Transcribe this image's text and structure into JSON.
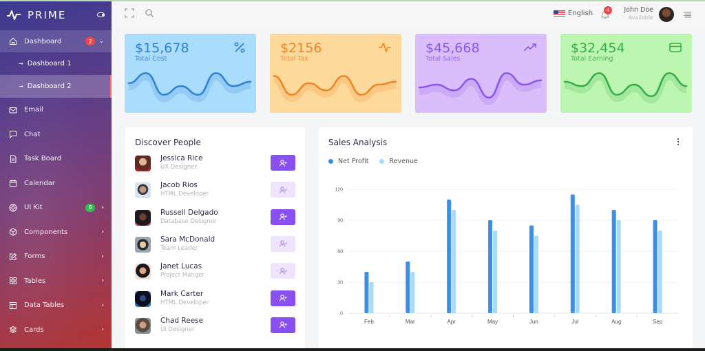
{
  "brand": {
    "name": "PRIME"
  },
  "sidebar": {
    "items": [
      {
        "label": "Dashboard",
        "icon": "home-icon",
        "badge": "2",
        "badge_color": "#f04646",
        "expanded": true,
        "children": [
          {
            "label": "Dashboard 1"
          },
          {
            "label": "Dashboard 2",
            "current": true
          }
        ]
      },
      {
        "label": "Email",
        "icon": "mail-icon"
      },
      {
        "label": "Chat",
        "icon": "chat-icon"
      },
      {
        "label": "Task Board",
        "icon": "file-icon"
      },
      {
        "label": "Calendar",
        "icon": "calendar-icon"
      },
      {
        "label": "UI Kit",
        "icon": "aperture-icon",
        "badge": "6",
        "badge_color": "#2fbf4e",
        "has_children": true
      },
      {
        "label": "Components",
        "icon": "box-icon",
        "has_children": true
      },
      {
        "label": "Forms",
        "icon": "edit-icon",
        "has_children": true
      },
      {
        "label": "Tables",
        "icon": "grid-icon",
        "has_children": true
      },
      {
        "label": "Data Tables",
        "icon": "layout-icon",
        "has_children": true
      },
      {
        "label": "Cards",
        "icon": "layers-icon",
        "has_children": true
      }
    ]
  },
  "header": {
    "language": "English",
    "notifications": "4",
    "user": {
      "name": "John Doe",
      "status": "Available"
    }
  },
  "stats": [
    {
      "value": "$15,678",
      "label": "Total Cost",
      "icon": "percent-icon",
      "color": "#2e7fd8",
      "spark": [
        0.45,
        0.1,
        0.85,
        0.55,
        0.85,
        0.1,
        0.55,
        0.4
      ]
    },
    {
      "value": "$2156",
      "label": "Total Tax",
      "icon": "activity-icon",
      "color": "#ef8424",
      "spark": [
        0.2,
        0.85,
        0.45,
        0.7,
        0.2,
        0.85,
        0.5,
        0.4
      ]
    },
    {
      "value": "$45,668",
      "label": "Total Sales",
      "icon": "trending-up-icon",
      "color": "#8c55ee",
      "spark": [
        0.6,
        0.5,
        0.7,
        0.3,
        0.95,
        0.1,
        0.5,
        0.35
      ]
    },
    {
      "value": "$32,454",
      "label": "Total Earning",
      "icon": "credit-card-icon",
      "color": "#32ad47",
      "spark": [
        0.4,
        0.55,
        0.1,
        0.85,
        0.5,
        0.9,
        0.1,
        0.55
      ]
    }
  ],
  "discover": {
    "title": "Discover People",
    "people": [
      {
        "name": "Jessica Rice",
        "role": "UX Designer",
        "followed": false
      },
      {
        "name": "Jacob Rios",
        "role": "HTML Developer",
        "followed": true
      },
      {
        "name": "Russell Delgado",
        "role": "Database Designer",
        "followed": false
      },
      {
        "name": "Sara McDonald",
        "role": "Team Leader",
        "followed": true
      },
      {
        "name": "Janet Lucas",
        "role": "Project Manger",
        "followed": true
      },
      {
        "name": "Mark Carter",
        "role": "HTML Developer",
        "followed": false
      },
      {
        "name": "Chad Reese",
        "role": "UI Designer",
        "followed": false
      }
    ]
  },
  "sales": {
    "title": "Sales Analysis",
    "legend": [
      {
        "label": "Net Profit",
        "color": "#3d8fe6"
      },
      {
        "label": "Revenue",
        "color": "#a9dafa"
      }
    ]
  },
  "chart_data": {
    "type": "bar",
    "title": "Sales Analysis",
    "categories": [
      "Feb",
      "Mar",
      "Apr",
      "May",
      "Jun",
      "Jul",
      "Aug",
      "Sep"
    ],
    "series": [
      {
        "name": "Net Profit",
        "color": "#3d8fe6",
        "values": [
          40,
          50,
          110,
          90,
          85,
          115,
          100,
          90
        ]
      },
      {
        "name": "Revenue",
        "color": "#a9dafa",
        "values": [
          30,
          40,
          100,
          80,
          75,
          105,
          90,
          80
        ]
      }
    ],
    "yticks": [
      0,
      30,
      60,
      90,
      120
    ],
    "ylim": [
      0,
      120
    ],
    "xlabel": "",
    "ylabel": "",
    "grid": true,
    "legend": "top-left"
  }
}
